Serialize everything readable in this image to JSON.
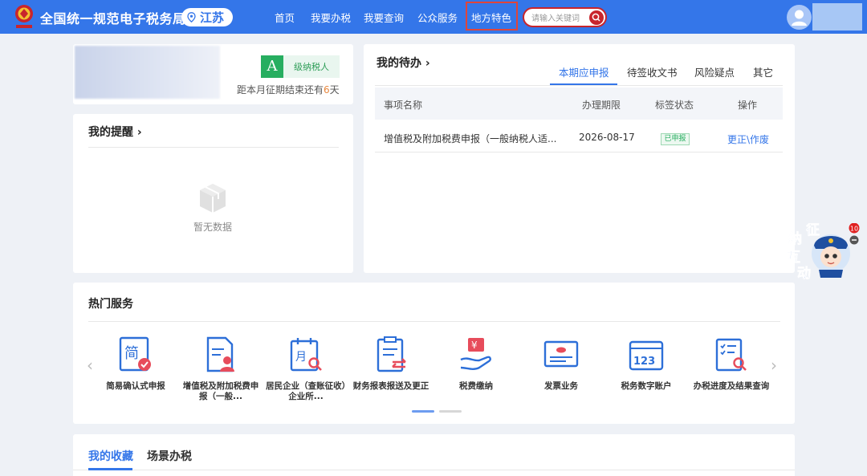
{
  "header": {
    "site_title": "全国统一规范电子税务局",
    "region": "江苏",
    "nav": [
      "首页",
      "我要办税",
      "我要查询",
      "公众服务",
      "地方特色"
    ],
    "search_placeholder": "请输入关键词",
    "accent_color": "#3476e9"
  },
  "taxpayer_card": {
    "credit_grade": "A",
    "grade_label": "级纳税人",
    "period_prefix": "距本月征期结束还有",
    "period_days": "6",
    "period_suffix": "天"
  },
  "reminders": {
    "title": "我的提醒 ›",
    "empty_text": "暂无数据"
  },
  "todo": {
    "title": "我的待办 ›",
    "tabs": [
      "本期应申报",
      "待签收文书",
      "风险疑点",
      "其它"
    ],
    "active_tab": "本期应申报",
    "columns": [
      "事项名称",
      "办理期限",
      "标签状态",
      "操作"
    ],
    "rows": [
      {
        "name": "增值税及附加税费申报（一般纳税人适...",
        "deadline": "2026-08-17",
        "status": "已申报",
        "action": "更正\\作废"
      }
    ]
  },
  "hot_services": {
    "title": "热门服务",
    "items": [
      {
        "label": "简易确认式申报",
        "icon": "simple-declare-icon"
      },
      {
        "label": "增值税及附加税费申报（一般...",
        "icon": "vat-declare-icon"
      },
      {
        "label": "居民企业（查账征收）企业所...",
        "icon": "corporate-tax-icon"
      },
      {
        "label": "财务报表报送及更正",
        "icon": "financial-report-icon"
      },
      {
        "label": "税费缴纳",
        "icon": "tax-payment-icon"
      },
      {
        "label": "发票业务",
        "icon": "invoice-icon"
      },
      {
        "label": "税务数字账户",
        "icon": "digital-account-icon"
      },
      {
        "label": "办税进度及结果查询",
        "icon": "progress-query-icon"
      }
    ]
  },
  "favorites": {
    "tabs": [
      "我的收藏",
      "场景办税"
    ],
    "active_tab": "我的收藏"
  },
  "float_widget": {
    "chars": [
      "征",
      "纳",
      "互",
      "动"
    ],
    "badge_count": "10"
  }
}
